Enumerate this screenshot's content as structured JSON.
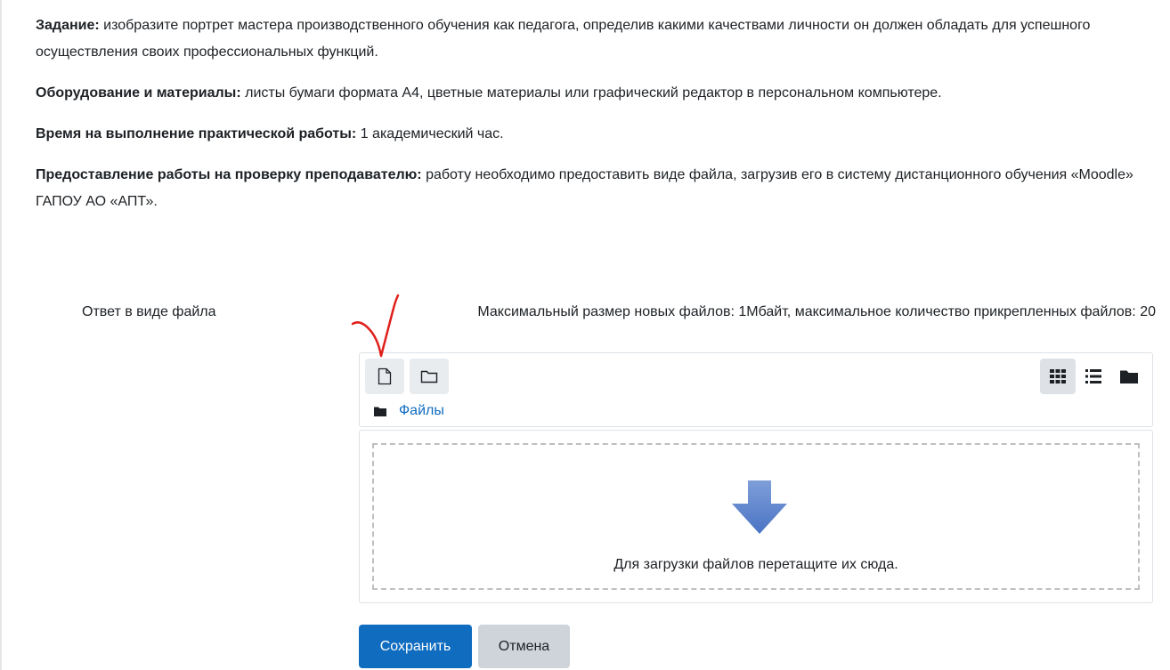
{
  "instructions": {
    "task": {
      "label": "Задание:",
      "text": " изобразите портрет мастера производственного обучения как педагога, определив какими качествами личности он должен обладать для успешного осуществления своих профессиональных функций."
    },
    "equipment": {
      "label": "Оборудование и материалы:",
      "text": " листы бумаги формата А4, цветные материалы или графический редактор в персональном компьютере."
    },
    "time": {
      "label": "Время на выполнение практической работы:",
      "text": " 1 академический час."
    },
    "submission": {
      "label": "Предоставление работы на проверку преподавателю:",
      "text": " работу необходимо предоставить виде файла, загрузив его в систему дистанционного обучения «Moodle» ГАПОУ АО «АПТ»."
    }
  },
  "form": {
    "field_label": "Ответ в виде файла",
    "limits_text": "Максимальный размер новых файлов: 1Мбайт, максимальное количество прикрепленных файлов: 20"
  },
  "filepicker": {
    "toolbar": {
      "add_file_icon": "file-icon",
      "create_folder_icon": "folder-outline-icon",
      "view_icons": [
        "grid-icon",
        "list-icon",
        "folder-icon"
      ],
      "active_view": "grid-icon"
    },
    "path": {
      "folder_label": "Файлы"
    },
    "dropzone": {
      "text": "Для загрузки файлов перетащите их сюда.",
      "arrow_icon": "down-arrow-icon"
    }
  },
  "actions": {
    "save_label": "Сохранить",
    "cancel_label": "Отмена"
  },
  "colors": {
    "primary": "#0f6cbf",
    "secondary": "#ced4da",
    "link": "#0f6cbf",
    "annotation_mark": "#e0201b"
  }
}
